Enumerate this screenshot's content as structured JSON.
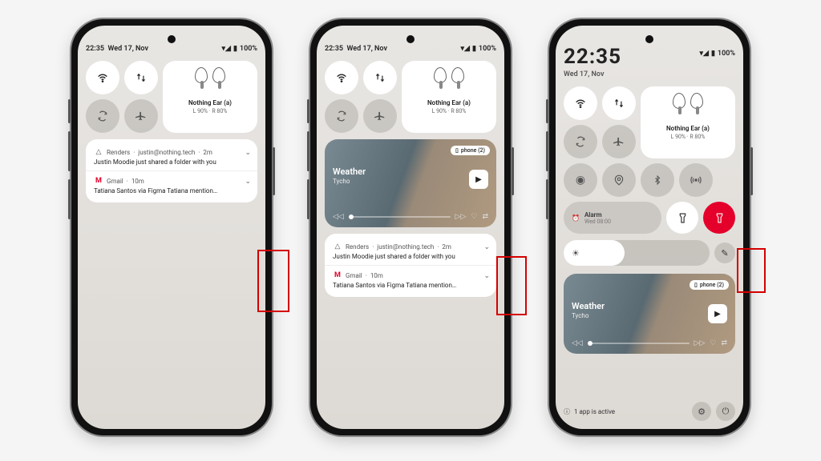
{
  "status": {
    "time_small": "22:35",
    "date_small": "Wed 17, Nov",
    "time_big": "22:35",
    "date_big": "Wed 17, Nov",
    "battery_text": "100%"
  },
  "earbuds": {
    "name": "Nothing Ear (a)",
    "battery": "L 90%  ·  R 80%"
  },
  "media": {
    "device_label": "phone (2)",
    "title": "Weather",
    "artist": "Tycho"
  },
  "notifications": [
    {
      "app": "Renders",
      "sender": "justin@nothing.tech",
      "time": "2m",
      "body": "Justin Moodie just shared a folder with you"
    },
    {
      "app": "Gmail",
      "time": "10m",
      "body": "Tatiana Santos via Figma  Tatiana mention…"
    }
  ],
  "alarm": {
    "label": "Alarm",
    "sub": "Wed 08:00"
  },
  "footer": {
    "active_text": "1 app is active"
  }
}
